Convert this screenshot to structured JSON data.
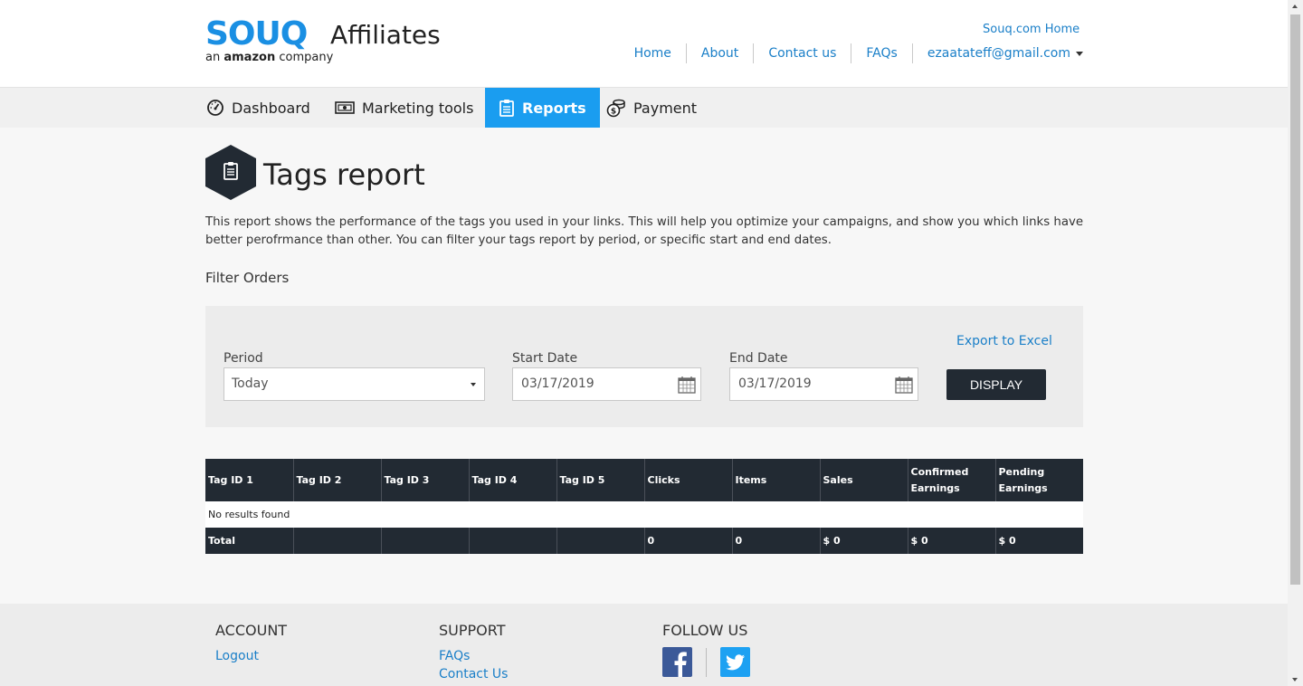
{
  "header": {
    "logo_wordmark": "SOUQ",
    "logo_product": "Affiliates",
    "logo_tagline_prefix": "an",
    "logo_tagline_brand": "amazon",
    "logo_tagline_suffix": "company",
    "top_link": "Souq.com Home",
    "nav": [
      "Home",
      "About",
      "Contact us",
      "FAQs"
    ],
    "user_email": "ezaatateff@gmail.com"
  },
  "tabs": [
    {
      "label": "Dashboard",
      "icon": "speedometer-icon",
      "active": false
    },
    {
      "label": "Marketing tools",
      "icon": "banner-icon",
      "active": false
    },
    {
      "label": "Reports",
      "icon": "clipboard-icon",
      "active": true
    },
    {
      "label": "Payment",
      "icon": "money-icon",
      "active": false
    }
  ],
  "page": {
    "title": "Tags report",
    "title_icon": "clipboard-icon",
    "description": "This report shows the performance of the tags you used in your links. This will help you optimize your campaigns, and show you which links have better perofrmance than other. You can filter your tags report by period, or specific start and end dates.",
    "filter_title": "Filter Orders"
  },
  "filters": {
    "period_label": "Period",
    "period_value": "Today",
    "start_label": "Start Date",
    "start_value": "03/17/2019",
    "end_label": "End Date",
    "end_value": "03/17/2019",
    "export_label": "Export to Excel",
    "display_label": "DISPLAY"
  },
  "table": {
    "headers": [
      "Tag ID 1",
      "Tag ID 2",
      "Tag ID 3",
      "Tag ID 4",
      "Tag ID 5",
      "Clicks",
      "Items",
      "Sales",
      "Confirmed Earnings",
      "Pending Earnings"
    ],
    "empty_message": "No results found",
    "total_row": [
      "Total",
      "",
      "",
      "",
      "",
      "0",
      "0",
      "$ 0",
      "$ 0",
      "$ 0"
    ]
  },
  "footer": {
    "account": {
      "title": "ACCOUNT",
      "links": [
        "Logout"
      ]
    },
    "support": {
      "title": "SUPPORT",
      "links": [
        "FAQs",
        "Contact Us"
      ]
    },
    "follow": {
      "title": "FOLLOW US",
      "icons": [
        "facebook-icon",
        "twitter-icon"
      ]
    }
  },
  "colors": {
    "brand_blue": "#1a8fe3",
    "active_tab": "#1a9df0",
    "dark": "#222a33",
    "link": "#1a7fc8"
  }
}
